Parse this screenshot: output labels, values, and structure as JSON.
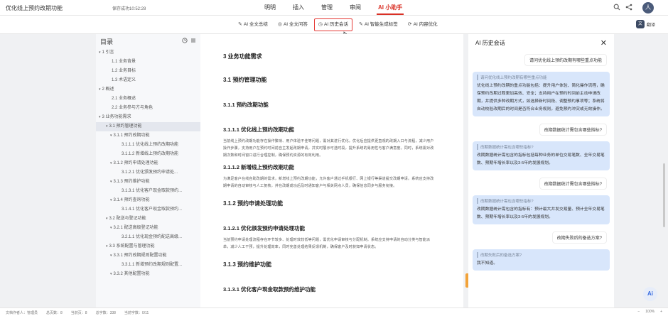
{
  "app": {
    "doc_title": "优化线上预约改期功能",
    "save_status": "保存成功10:52:28"
  },
  "menu": [
    {
      "label": "明明",
      "active": false
    },
    {
      "label": "插入",
      "active": false
    },
    {
      "label": "管理",
      "active": false
    },
    {
      "label": "审阅",
      "active": false
    },
    {
      "label": "AI 小助手",
      "active": true
    }
  ],
  "top_icons": {
    "search": "search-icon",
    "share": "share-icon",
    "avatar_initial": "人"
  },
  "toolbar": {
    "tools": [
      {
        "icon": "✎",
        "label": "AI 全文总结",
        "highlight": false
      },
      {
        "icon": "◎",
        "label": "AI 全文问答",
        "highlight": false
      },
      {
        "icon": "◷",
        "label": "AI 历史会话",
        "highlight": true
      },
      {
        "icon": "✎",
        "label": "AI 智能生成标签",
        "highlight": false
      },
      {
        "icon": "⟳",
        "label": "AI 内容优化",
        "highlight": false
      }
    ],
    "translate_label": "翻译",
    "translate_icon": "文"
  },
  "outline": {
    "title": "目录",
    "items": [
      {
        "text": "1 引言",
        "caret": "▾",
        "indent": 1,
        "selected": false
      },
      {
        "text": "1.1 业务背景",
        "caret": "",
        "indent": 2,
        "selected": false
      },
      {
        "text": "1.2 业务目标",
        "caret": "",
        "indent": 2,
        "selected": false
      },
      {
        "text": "1.3 术语定义",
        "caret": "",
        "indent": 2,
        "selected": false
      },
      {
        "text": "2 概述",
        "caret": "▾",
        "indent": 1,
        "selected": false
      },
      {
        "text": "2.1 业务概述",
        "caret": "",
        "indent": 2,
        "selected": false
      },
      {
        "text": "2.2 业务参与方与角色",
        "caret": "",
        "indent": 2,
        "selected": false
      },
      {
        "text": "3 业务功能需求",
        "caret": "▾",
        "indent": 1,
        "selected": false
      },
      {
        "text": "3.1 预约管理功能",
        "caret": "▾",
        "indent": 2,
        "selected": true
      },
      {
        "text": "3.1.1 预约改期功能",
        "caret": "▾",
        "indent": 3,
        "selected": false
      },
      {
        "text": "3.1.1.1 优化线上预约改期功能",
        "caret": "",
        "indent": 4,
        "selected": false
      },
      {
        "text": "3.1.1.2 新增线上预约改期功能",
        "caret": "",
        "indent": 4,
        "selected": false
      },
      {
        "text": "3.1.2 预约申请处理功能",
        "caret": "▾",
        "indent": 3,
        "selected": false
      },
      {
        "text": "3.1.2.1 优化颁发预约申请处...",
        "caret": "",
        "indent": 4,
        "selected": false
      },
      {
        "text": "3.1.3 预约维护功能",
        "caret": "▾",
        "indent": 3,
        "selected": false
      },
      {
        "text": "3.1.3.1 优化客户现金取款预约...",
        "caret": "",
        "indent": 4,
        "selected": false
      },
      {
        "text": "3.1.4 预约查询功能",
        "caret": "▾",
        "indent": 3,
        "selected": false
      },
      {
        "text": "3.1.4.1 优化客户现金取款预约...",
        "caret": "",
        "indent": 4,
        "selected": false
      },
      {
        "text": "3.2 配送与登记功能",
        "caret": "▾",
        "indent": 2,
        "selected": false
      },
      {
        "text": "3.2.1 配送高级登记功能",
        "caret": "▾",
        "indent": 3,
        "selected": false
      },
      {
        "text": "3.2.1.1 优化现金预约配送高级...",
        "caret": "",
        "indent": 4,
        "selected": false
      },
      {
        "text": "3.3 系统配置与管理功能",
        "caret": "▾",
        "indent": 2,
        "selected": false
      },
      {
        "text": "3.3.1 预约改期规则配置功能",
        "caret": "▾",
        "indent": 3,
        "selected": false
      },
      {
        "text": "3.3.1.1 新增预约改期规则配置...",
        "caret": "",
        "indent": 4,
        "selected": false
      },
      {
        "text": "3.3.2 其他配置功能",
        "caret": "▾",
        "indent": 3,
        "selected": false
      }
    ]
  },
  "document": {
    "blocks": [
      {
        "type": "h-l1",
        "text": "3 业务功能需求"
      },
      {
        "type": "h-l2",
        "text": "3.1 预约管理功能"
      },
      {
        "type": "h-l3",
        "text": "3.1.1 预约改期功能"
      },
      {
        "type": "h-l4",
        "text": "3.1.1.1 优化线上预约改期功能"
      },
      {
        "type": "para",
        "text": "当前线上预约改期功能存在操作繁琐、用户体验不佳等问题，需对其进行优化。优化后应提供更直观的改期入口与流程，减少用户操作步骤，支持用户在预约时间前自主发起改期申请，并实时展示可选时段，提升系统的易用性与客户满意度。同时，系统需对改期次数和时间窗口进行合理控制，确保预约资源的有效利用。"
      },
      {
        "type": "h-l4",
        "text": "3.1.1.2 新增线上预约改期功能"
      },
      {
        "type": "para",
        "text": "为满足客户在线自助改期的需求，新增线上预约改期功能，允许客户通过手机银行、网上银行等渠道提交改期申请。系统应支持改期申请的自动审核与人工复核，并在改期成功后及时通知客户与相关网点人员，确保信息同步与服务衔接。"
      },
      {
        "type": "h-l2b",
        "text": "3.1.2 预约申请处理功能"
      },
      {
        "type": "h-l4",
        "text": "3.1.2.1 优化颁发预约申请处理功能"
      },
      {
        "type": "para",
        "text": "当前预约申请处理流程存在环节较多、处理时效较低等问题，需优化申请审核与分配机制。系统应支持申请的自动分类与智能派单，减少人工干预，提升处理效率，同时完善处理结果反馈机制，确保客户及时获知申请状态。"
      },
      {
        "type": "h-l2b",
        "text": "3.1.3 预约维护功能"
      },
      {
        "type": "h-l4",
        "text": "3.1.3.1 优化客户现金取款预约维护功能"
      }
    ]
  },
  "ai_panel": {
    "title": "AI 历史会话",
    "close_icon": "close-icon",
    "first_query": "请问优化线上预约改期有哪些重点功能",
    "messages": [
      {
        "quote": "请问优化线上预约改期有哪些重点功能",
        "answer": "优化线上预约改期的重点功能包括：提升用户体验、简化操作流程，确保预约改期过程更加高效、安全；支持用户在预约时间前主动申请改期，并提供多种改期方式，如选择新时间段、调整预约事项等；系统将自动校验改期后的时间是否符合业务规则，避免预约冲突或无效操作。"
      },
      {
        "question": "改期数据统计需包含哪些指标?"
      },
      {
        "quote": "改期数据统计需包含哪些指标?",
        "answer": "改期数据统计需包含的指标包括每种业务的单位交易笔数、全年交易笔数、预期年增长率以及3-5年的发展规划。"
      },
      {
        "question": "改期数据统计需包含哪些指标?"
      },
      {
        "quote": "改期数据统计需包含哪些指标?",
        "answer": "改期数据统计需包含的指标有：预计最大并发交易量、预计全年交易笔数、预期年增长率以及3-5年的发展规划。"
      },
      {
        "question": "改期失败后的备选方案?"
      },
      {
        "quote": "改期失败后的备选方案?",
        "answer": "我不知道。"
      }
    ]
  },
  "ai_float_label": "Ai",
  "statusbar": {
    "left": [
      "文档作者人：管理员",
      "总页数：8",
      "当前页：8",
      "总字数：338",
      "当前字数：0/11"
    ],
    "zoom": "100%"
  }
}
